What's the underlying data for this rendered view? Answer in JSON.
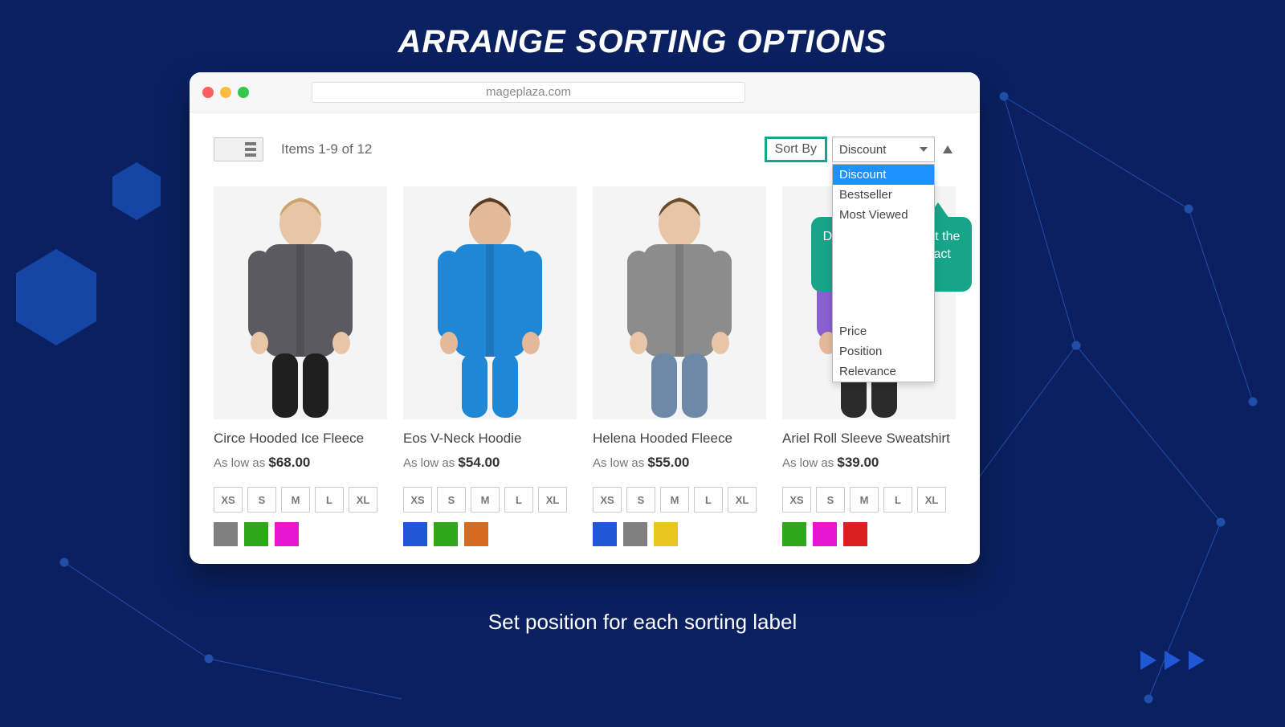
{
  "headline": "ARRANGE SORTING OPTIONS",
  "subline": "Set position for each sorting label",
  "url": "mageplaza.com",
  "toolbar": {
    "items_count": "Items 1-9 of 12",
    "sort_label": "Sort By",
    "sort_selected": "Discount",
    "options_top": [
      "Discount",
      "Bestseller",
      "Most Viewed"
    ],
    "options_bottom": [
      "Price",
      "Position",
      "Relevance"
    ]
  },
  "callout": "Discount option is at the 1st position to attract customers",
  "price_prefix": "As low as",
  "sizes": [
    "XS",
    "S",
    "M",
    "L",
    "XL"
  ],
  "products": [
    {
      "name": "Circe Hooded Ice Fleece",
      "price": "$68.00",
      "garment": "#5a5a60",
      "accent": "#1f1f1f",
      "skin": "#e9c5a8",
      "hair": "#c9a46b",
      "swatches": [
        "#808080",
        "#2ea718",
        "#e815d1"
      ]
    },
    {
      "name": "Eos V-Neck Hoodie",
      "price": "$54.00",
      "garment": "#1f87d6",
      "accent": "#1f87d6",
      "skin": "#e3b999",
      "hair": "#5a3a1f",
      "swatches": [
        "#1f57d6",
        "#2ea718",
        "#d66a1f"
      ]
    },
    {
      "name": "Helena Hooded Fleece",
      "price": "$55.00",
      "garment": "#8c8c8c",
      "accent": "#6e88a8",
      "skin": "#e9c5a8",
      "hair": "#6b4a2a",
      "swatches": [
        "#1f57d6",
        "#808080",
        "#e8c61f"
      ]
    },
    {
      "name": "Ariel Roll Sleeve Sweatshirt",
      "price": "$39.00",
      "garment": "#8a5fd1",
      "accent": "#2b2b2b",
      "skin": "#e3b999",
      "hair": "#6b4a2a",
      "swatches": [
        "#2ea718",
        "#e815d1",
        "#d91f1f"
      ]
    }
  ]
}
